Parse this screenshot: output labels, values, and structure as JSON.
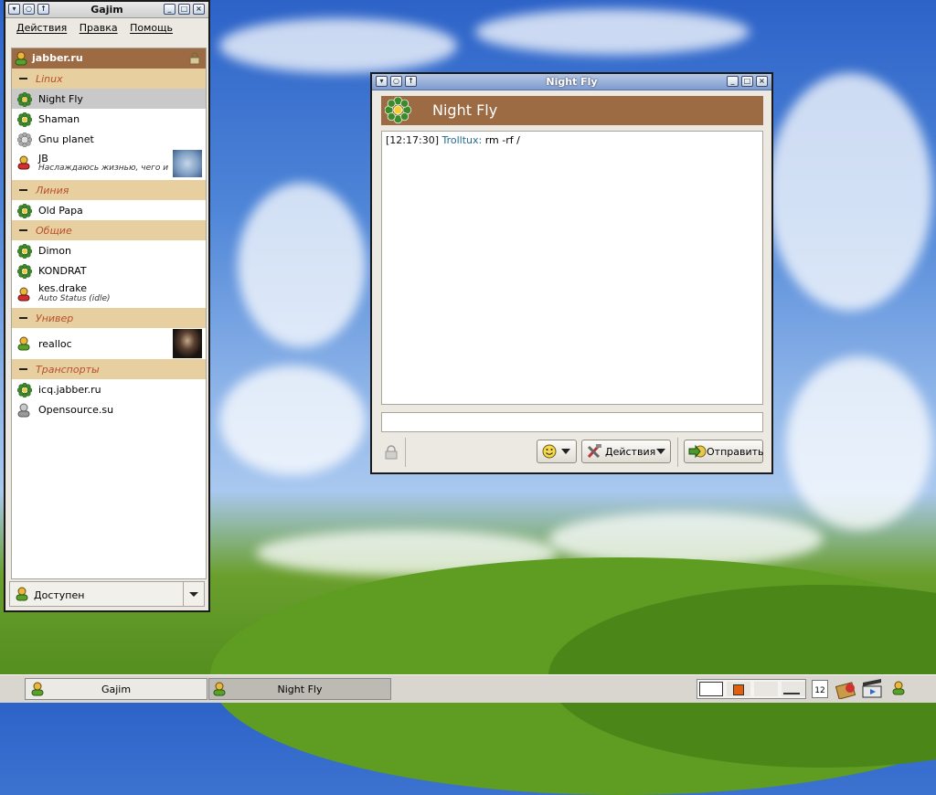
{
  "roster_window": {
    "title": "Gajim",
    "menu": [
      "Действия",
      "Правка",
      "Помощь"
    ],
    "account": "jabber.ru",
    "groups": [
      {
        "name": "Linux",
        "contacts": [
          {
            "name": "Night Fly",
            "status": ""
          },
          {
            "name": "Shaman",
            "status": ""
          },
          {
            "name": "Gnu planet",
            "status": ""
          },
          {
            "name": "JB",
            "status": "Наслаждаюсь жизнью, чего и"
          }
        ]
      },
      {
        "name": "Линия",
        "contacts": [
          {
            "name": "Old Papa",
            "status": ""
          }
        ]
      },
      {
        "name": "Общие",
        "contacts": [
          {
            "name": "Dimon",
            "status": ""
          },
          {
            "name": "KONDRAT",
            "status": ""
          },
          {
            "name": "kes.drake",
            "status": "Auto Status (idle)"
          }
        ]
      },
      {
        "name": "Универ",
        "contacts": [
          {
            "name": "realloc",
            "status": ""
          }
        ]
      },
      {
        "name": "Транспорты",
        "contacts": [
          {
            "name": "icq.jabber.ru",
            "status": ""
          },
          {
            "name": "Opensource.su",
            "status": ""
          }
        ]
      }
    ],
    "presence": "Доступен"
  },
  "chat_window": {
    "title": "Night Fly",
    "contact": "Night Fly",
    "message": {
      "time": "[12:17:30]",
      "sender": "Trolltux:",
      "text": " rm -rf /"
    },
    "actions_label": "Действия",
    "send_label": "Отправить"
  },
  "taskbar": {
    "tasks": [
      "Gajim",
      "Night Fly"
    ],
    "calendar_day": "12"
  },
  "colors": {
    "banner": "#9c6a43",
    "group_bg": "#e8cfa0",
    "group_text": "#b5502a"
  }
}
